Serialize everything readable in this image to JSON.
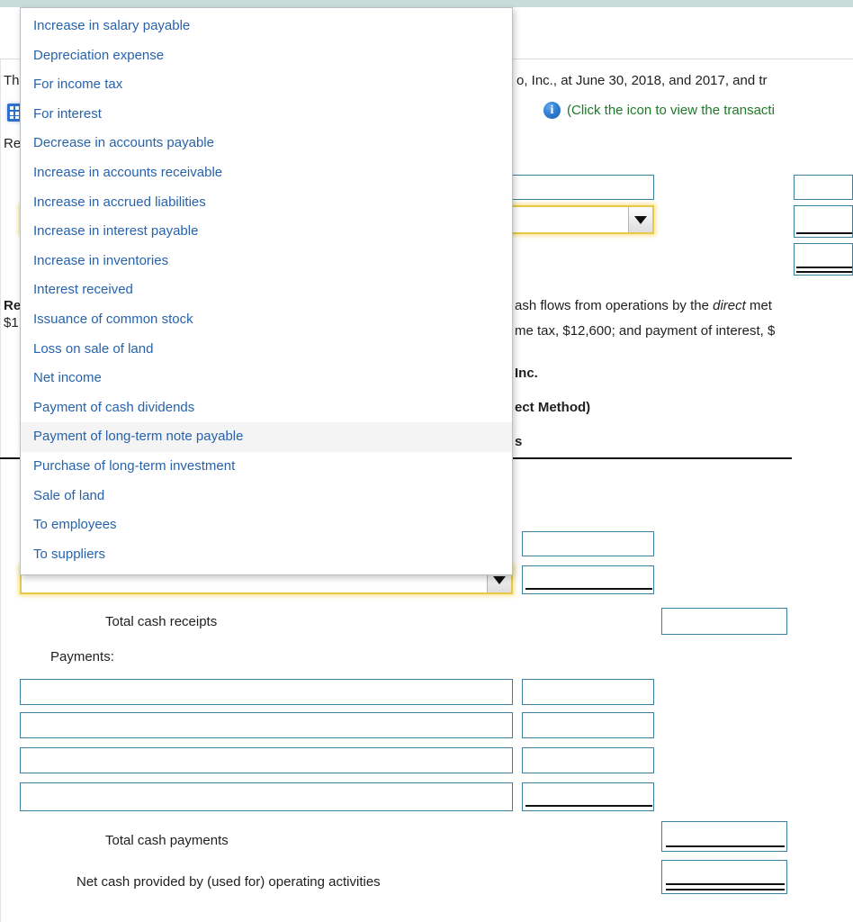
{
  "window": {
    "top_strip_color": "#c8dcda"
  },
  "problem": {
    "intro_prefix": "Th",
    "intro_visible": "o, Inc., at June 30, 2018, and 2017, and tr",
    "icon_hint": "(Click the icon to view the transacti",
    "requirement_label": "Re",
    "req_bold_prefix": "Re",
    "req_money_prefix": "$1",
    "req_line1_visible": "ash flows from operations by the ",
    "req_line1_italic": "direct",
    "req_line1_tail": " met",
    "req_line2_visible": "me tax, $12,600; and payment of interest, $"
  },
  "statement": {
    "company_visible": " Inc.",
    "method_visible": "ect Method)",
    "receipts_heading_visible": "s",
    "total_cash_receipts": "Total cash receipts",
    "payments_heading": "Payments:",
    "total_cash_payments": "Total cash payments",
    "net_cash": "Net cash provided by (used for) operating activities"
  },
  "dropdown": {
    "open": true,
    "text_color": "#2763ac",
    "hover_background": "#f4f4f4",
    "hovered_index": 14,
    "options": [
      "Increase in salary payable",
      "Depreciation expense",
      "For income tax",
      "For interest",
      "Decrease in accounts payable",
      "Increase in accounts receivable",
      "Increase in accrued liabilities",
      "Increase in interest payable",
      "Increase in inventories",
      "Interest received",
      "Issuance of common stock",
      "Loss on sale of land",
      "Net income",
      "Payment of cash dividends",
      "Payment of long-term note payable",
      "Purchase of long-term investment",
      "Sale of land",
      "To employees",
      "To suppliers"
    ]
  },
  "combo_boxes": {
    "focused_border_color": "#e8c84a",
    "arrow_glyph": "chevron-down",
    "selected_value_top": "",
    "selected_value_bottom": ""
  },
  "icons": {
    "grid": "table-grid-icon",
    "info": "info-circle-icon",
    "info_glyph": "i"
  },
  "colors": {
    "answer_box_border": "#3b7f9e",
    "link_blue": "#2763ac",
    "hint_green": "#1d7a26"
  }
}
